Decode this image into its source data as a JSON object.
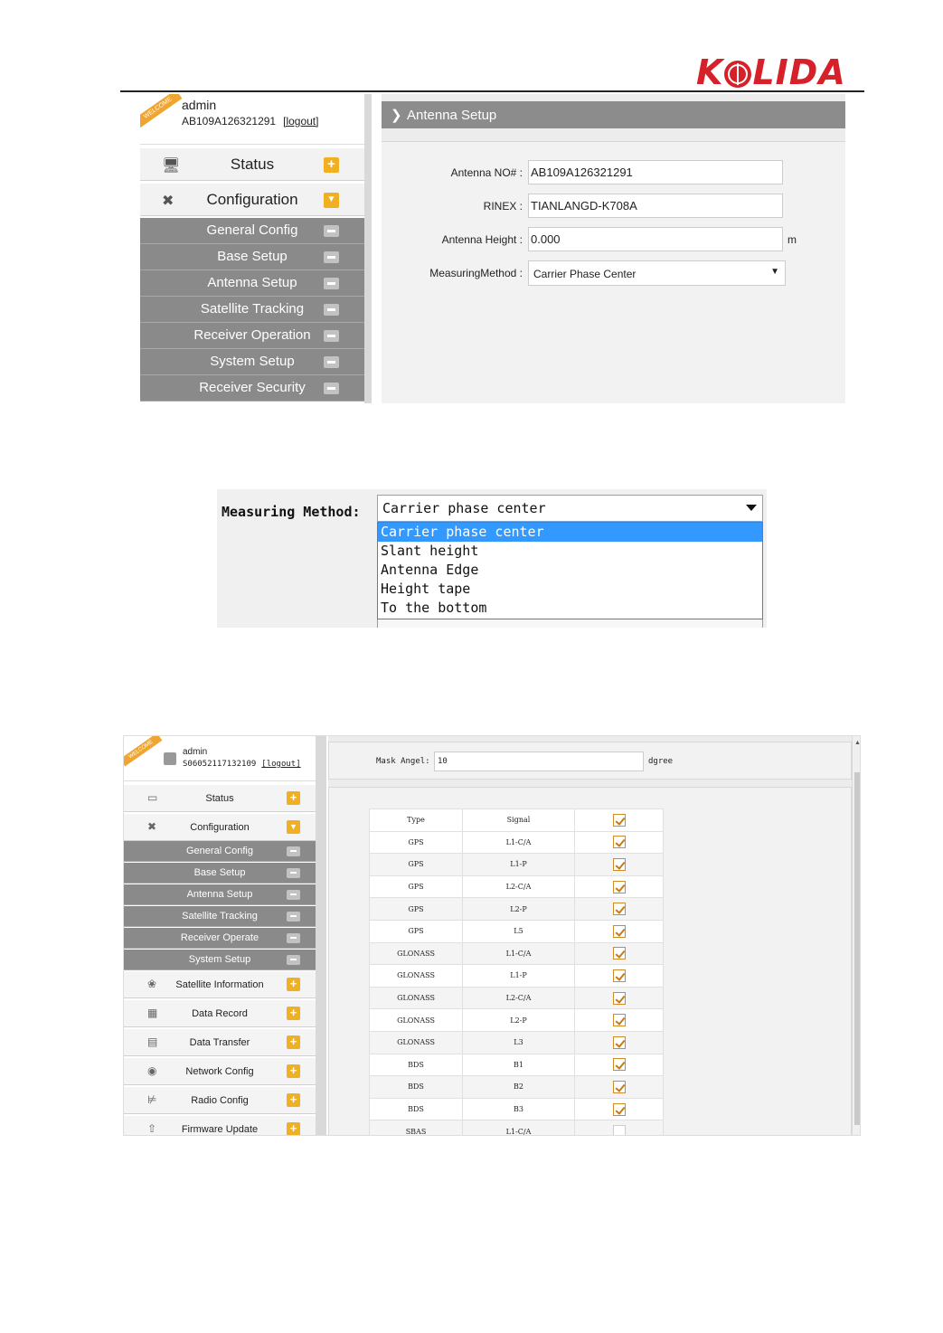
{
  "logo": {
    "text_before": "K",
    "text_after": "LIDA"
  },
  "shot1": {
    "user": "admin",
    "serial": "AB109A126321291",
    "logout": "[logout]",
    "ribbon": "WELCOME",
    "nav": [
      {
        "label": "Status",
        "icon": "monitor-icon"
      },
      {
        "label": "Configuration",
        "icon": "tools-icon"
      }
    ],
    "submenu": [
      "General Config",
      "Base Setup",
      "Antenna Setup",
      "Satellite Tracking",
      "Receiver Operation",
      "System Setup",
      "Receiver Security"
    ],
    "header": "Antenna Setup",
    "fields": {
      "antenna_no_label": "Antenna NO# :",
      "antenna_no": "AB109A126321291",
      "rinex_label": "RINEX :",
      "rinex": "TIANLANGD-K708A",
      "height_label": "Antenna Height :",
      "height": "0.000",
      "height_unit": "m",
      "method_label": "MeasuringMethod :",
      "method": "Carrier Phase Center"
    }
  },
  "shot2": {
    "label": "Measuring Method:",
    "selected": "Carrier phase center",
    "options": [
      "Carrier phase center",
      "Slant height",
      "Antenna Edge",
      "Height tape",
      "To the bottom"
    ]
  },
  "shot3": {
    "user": "admin",
    "serial": "S06052117132109",
    "logout": "[logout]",
    "ribbon": "WELCOME",
    "nav_top": [
      {
        "label": "Status",
        "icon": "monitor-icon"
      },
      {
        "label": "Configuration",
        "icon": "tools-icon"
      }
    ],
    "submenu": [
      "General Config",
      "Base Setup",
      "Antenna Setup",
      "Satellite Tracking",
      "Receiver Operate",
      "System Setup"
    ],
    "nav_bottom": [
      {
        "label": "Satellite Information",
        "icon": "satellite-icon"
      },
      {
        "label": "Data Record",
        "icon": "calendar-icon"
      },
      {
        "label": "Data Transfer",
        "icon": "network-icon"
      },
      {
        "label": "Network Config",
        "icon": "globe-icon"
      },
      {
        "label": "Radio Config",
        "icon": "antenna-icon"
      },
      {
        "label": "Firmware Update",
        "icon": "upload-icon"
      }
    ],
    "mask_label": "Mask Angel:",
    "mask_value": "10",
    "mask_unit": "dgree",
    "table": {
      "headers": [
        "Type",
        "Signal"
      ],
      "rows": [
        {
          "type": "GPS",
          "signal": "L1-C/A",
          "checked": true
        },
        {
          "type": "GPS",
          "signal": "L1-P",
          "checked": true
        },
        {
          "type": "GPS",
          "signal": "L2-C/A",
          "checked": true
        },
        {
          "type": "GPS",
          "signal": "L2-P",
          "checked": true
        },
        {
          "type": "GPS",
          "signal": "L5",
          "checked": true
        },
        {
          "type": "GLONASS",
          "signal": "L1-C/A",
          "checked": true
        },
        {
          "type": "GLONASS",
          "signal": "L1-P",
          "checked": true
        },
        {
          "type": "GLONASS",
          "signal": "L2-C/A",
          "checked": true
        },
        {
          "type": "GLONASS",
          "signal": "L2-P",
          "checked": true
        },
        {
          "type": "GLONASS",
          "signal": "L3",
          "checked": true
        },
        {
          "type": "BDS",
          "signal": "B1",
          "checked": true
        },
        {
          "type": "BDS",
          "signal": "B2",
          "checked": true
        },
        {
          "type": "BDS",
          "signal": "B3",
          "checked": true
        },
        {
          "type": "SBAS",
          "signal": "L1-C/A",
          "checked": false
        }
      ]
    }
  },
  "colors": {
    "brand_red": "#d6202a",
    "accent_orange": "#f0b021",
    "menu_gray": "#8a8a8a",
    "selection_blue": "#3399ff"
  }
}
